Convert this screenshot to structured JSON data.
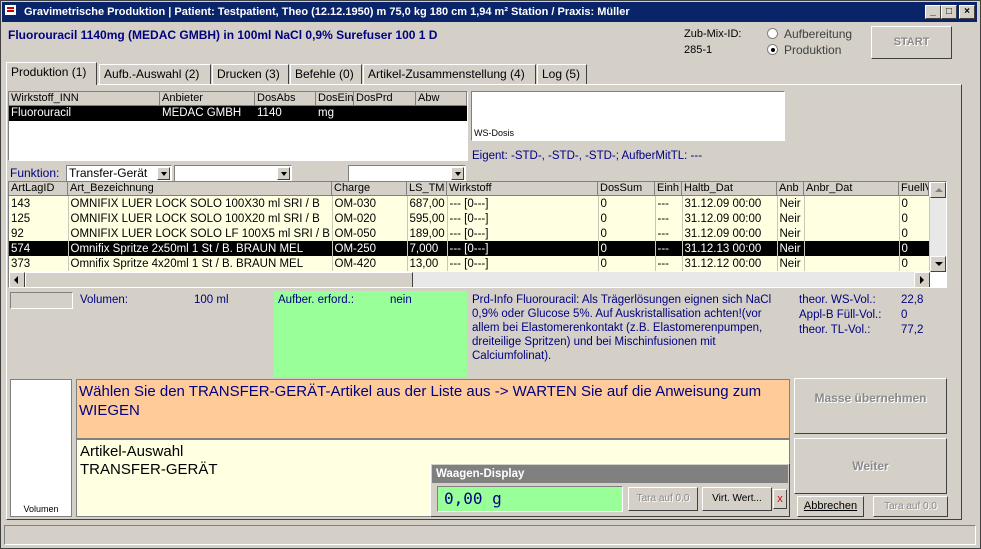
{
  "window": {
    "title": "Gravimetrische Produktion  |  Patient: Testpatient, Theo (12.12.1950) m 75,0 kg  180 cm  1,94 m² Station / Praxis: Müller",
    "min_label": "_",
    "max_label": "□",
    "close_label": "×"
  },
  "header": {
    "product": "Fluorouracil 1140mg (MEDAC GMBH) in 100ml NaCl 0,9% Surefuser 100 1 D",
    "zub_label": "Zub-Mix-ID:",
    "zub_value": "285-1",
    "radio_aufbereitung": "Aufbereitung",
    "radio_produktion": "Produktion",
    "start_label": "START"
  },
  "tabs": [
    {
      "label": "Produktion (1)"
    },
    {
      "label": "Aufb.-Auswahl (2)"
    },
    {
      "label": "Drucken (3)"
    },
    {
      "label": "Befehle (0)"
    },
    {
      "label": "Artikel-Zusammenstellung (4)"
    },
    {
      "label": "Log (5)"
    }
  ],
  "wirkstoff_table": {
    "headers": [
      "Wirkstoff_INN",
      "Anbieter",
      "DosAbs",
      "DosEin",
      "DosPrd",
      "Abw"
    ],
    "rows": [
      [
        "Fluorouracil",
        "MEDAC GMBH",
        "1140",
        "mg",
        "",
        ""
      ]
    ]
  },
  "ws_dosis": {
    "label": "WS-Dosis",
    "eigent": "Eigent: -STD-, -STD-, -STD-; AufberMitTL: ---"
  },
  "funktion": {
    "label": "Funktion:",
    "value": "Transfer-Gerät",
    "combo2": "",
    "combo3": ""
  },
  "article_table": {
    "headers": [
      "ArtLagID",
      "Art_Bezeichnung",
      "Charge",
      "LS_TM",
      "Wirkstoff",
      "DosSum",
      "Einh",
      "Haltb_Dat",
      "Anb",
      "Anbr_Dat",
      "FuellV"
    ],
    "rows": [
      [
        "143",
        "OMNIFIX LUER LOCK SOLO    100X30 ml SRI   / B",
        "OM-030",
        "687,00",
        "--- [0---]",
        "0",
        "---",
        "31.12.09 00:00",
        "Neir",
        "",
        "0"
      ],
      [
        "125",
        "OMNIFIX LUER LOCK SOLO    100X20 ml SRI   / B",
        "OM-020",
        "595,00",
        "--- [0---]",
        "0",
        "---",
        "31.12.09 00:00",
        "Neir",
        "",
        "0"
      ],
      [
        "92",
        "OMNIFIX LUER LOCK SOLO LF   100X5 ml SRI   / B",
        "OM-050",
        "189,00",
        "--- [0---]",
        "0",
        "---",
        "31.12.09 00:00",
        "Neir",
        "",
        "0"
      ],
      [
        "574",
        "Omnifix Spritze 2x50ml   1 St   / B. BRAUN MEL",
        "OM-250",
        "7,000",
        "--- [0---]",
        "0",
        "---",
        "31.12.13 00:00",
        "Neir",
        "",
        "0"
      ],
      [
        "373",
        "Omnifix Spritze 4x20ml   1 St   / B. BRAUN MEL",
        "OM-420",
        "13,00",
        "--- [0---]",
        "0",
        "---",
        "31.12.12 00:00",
        "Neir",
        "",
        "0"
      ]
    ],
    "selected_index": 3
  },
  "info": {
    "volumen_label": "Volumen:",
    "volumen_value": "100 ml",
    "aufber_label": "Aufber. erford.:",
    "aufber_value": "nein",
    "prd_info": "Prd-Info Fluorouracil: Als Trägerlösungen eignen sich NaCl 0,9% oder Glucose 5%. Auf Auskristallisation achten!(vor allem bei Elastomerenkontakt (z.B. Elastomerenpumpen, dreiteilige Spritzen) und bei Mischinfusionen mit Calciumfolinat).",
    "theor_ws_label": "theor. WS-Vol.:",
    "theor_ws_value": "22,8",
    "applb_label": "Appl-B Füll-Vol.:",
    "applb_value": "0",
    "theor_tl_label": "theor. TL-Vol.:",
    "theor_tl_value": "77,2"
  },
  "instructions": {
    "message": "Wählen Sie den TRANSFER-GERÄT-Artikel aus der Liste aus -> WARTEN Sie auf die Anweisung zum WIEGEN",
    "line1": "Artikel-Auswahl",
    "line2": "TRANSFER-GERÄT",
    "volumen_bar_label": "Volumen"
  },
  "buttons": {
    "masse": "Masse übernehmen",
    "weiter": "Weiter",
    "abbrechen": "Abbrechen",
    "tara_main": "Tara auf 0.0"
  },
  "waagen": {
    "title": "Waagen-Display",
    "value": "0,00  g",
    "tara": "Tara auf 0.0",
    "virt": "Virt. Wert...",
    "close": "x"
  },
  "colors": {
    "titlebar": "#0a246a",
    "grid_bg": "#ffffe1",
    "green_panel": "#99ff99",
    "orange_panel": "#ffcc99",
    "text_blue": "#000080"
  }
}
